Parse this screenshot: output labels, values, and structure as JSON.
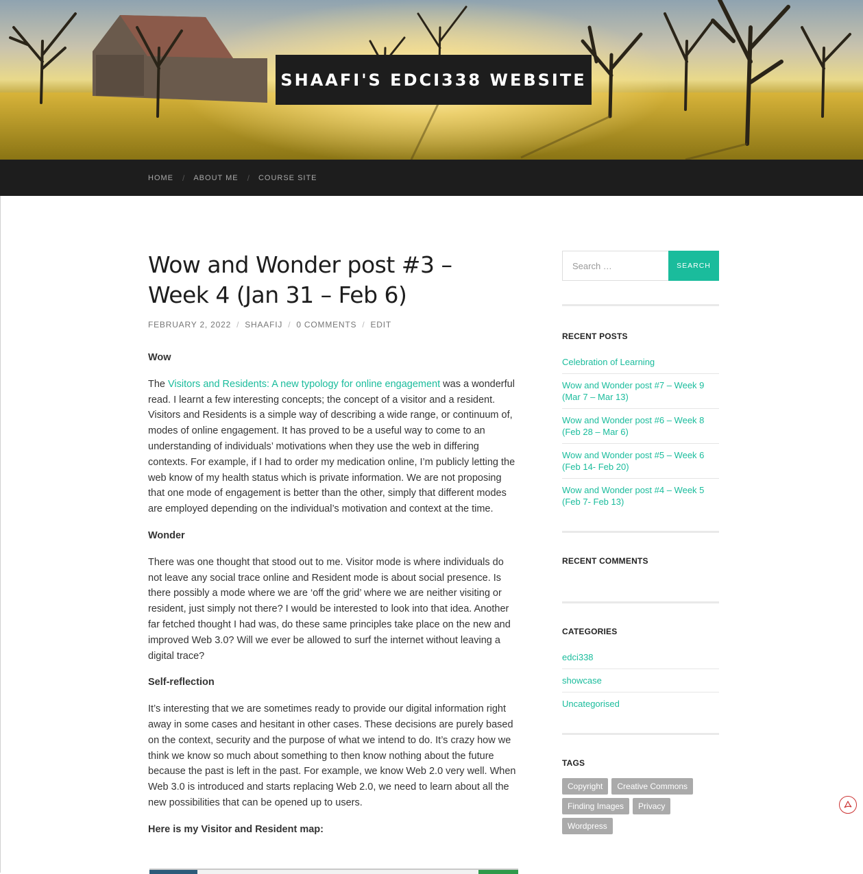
{
  "site": {
    "title": "SHAAFI'S EDCI338 WEBSITE"
  },
  "nav": {
    "items": [
      "HOME",
      "ABOUT ME",
      "COURSE SITE"
    ]
  },
  "post": {
    "title": "Wow and Wonder post #3 – Week 4 (Jan 31 – Feb 6)",
    "meta": {
      "date": "FEBRUARY 2, 2022",
      "author": "SHAAFIJ",
      "comments": "0 COMMENTS",
      "edit": "EDIT"
    },
    "heading_wow": "Wow",
    "p1_prefix": "The ",
    "p1_link": "Visitors and Residents: A new typology for online engagement",
    "p1_rest": " was a wonderful read. I learnt a few interesting concepts; the concept of a visitor and a resident. Visitors and Residents is a simple way of describing a wide range, or continuum of, modes of online engagement. It has proved to be a useful way to come to an understanding of individuals’ motivations when they use the web in differing contexts. For example, if I had to order my medication online, I’m publicly letting the web know of my health status which is private information. We are not proposing that one mode of engagement is better than the other, simply that different modes are employed depending on the individual’s motivation and context at the time.",
    "heading_wonder": "Wonder",
    "p2": "There was one thought that stood out to me. Visitor mode is where individuals do not leave any social trace online and Resident mode is about social presence. Is there possibly a mode where we are ‘off the grid’ where we are neither visiting or resident, just simply not there? I would be interested to look into that idea. Another far fetched thought I had was, do these same principles take place on the new and improved Web 3.0? Will we ever be allowed to surf the internet without leaving a digital trace?",
    "heading_reflection": "Self-reflection",
    "p3": "It’s interesting that we are sometimes ready to provide our digital information right away in some cases and hesitant in other cases. These decisions are purely based on the context, security and the purpose of what we intend to do. It’s crazy how we think we know so much about something to then know nothing about the future because the past is left in the past. For example, we know Web 2.0 very well. When Web 3.0 is introduced and starts replacing Web 2.0, we need to learn about all the new possibilities that can be opened up to users.",
    "heading_map": "Here is my Visitor and Resident map:"
  },
  "sidebar": {
    "search": {
      "placeholder": "Search …",
      "button": "SEARCH"
    },
    "recent_posts": {
      "title": "RECENT POSTS",
      "items": [
        "Celebration of Learning",
        "Wow and Wonder post #7 – Week 9 (Mar 7 – Mar 13)",
        "Wow and Wonder post #6 – Week 8 (Feb 28 – Mar 6)",
        "Wow and Wonder post #5 – Week 6 (Feb 14- Feb 20)",
        "Wow and Wonder post #4 – Week 5 (Feb 7- Feb 13)"
      ]
    },
    "recent_comments": {
      "title": "RECENT COMMENTS"
    },
    "categories": {
      "title": "CATEGORIES",
      "items": [
        "edci338",
        "showcase",
        "Uncategorised"
      ]
    },
    "tags": {
      "title": "TAGS",
      "items": [
        "Copyright",
        "Creative Commons",
        "Finding Images",
        "Privacy",
        "Wordpress"
      ]
    }
  },
  "colors": {
    "accent": "#1abc9c",
    "dark": "#1d1d1d",
    "tag_bg": "#aaaaaa"
  }
}
